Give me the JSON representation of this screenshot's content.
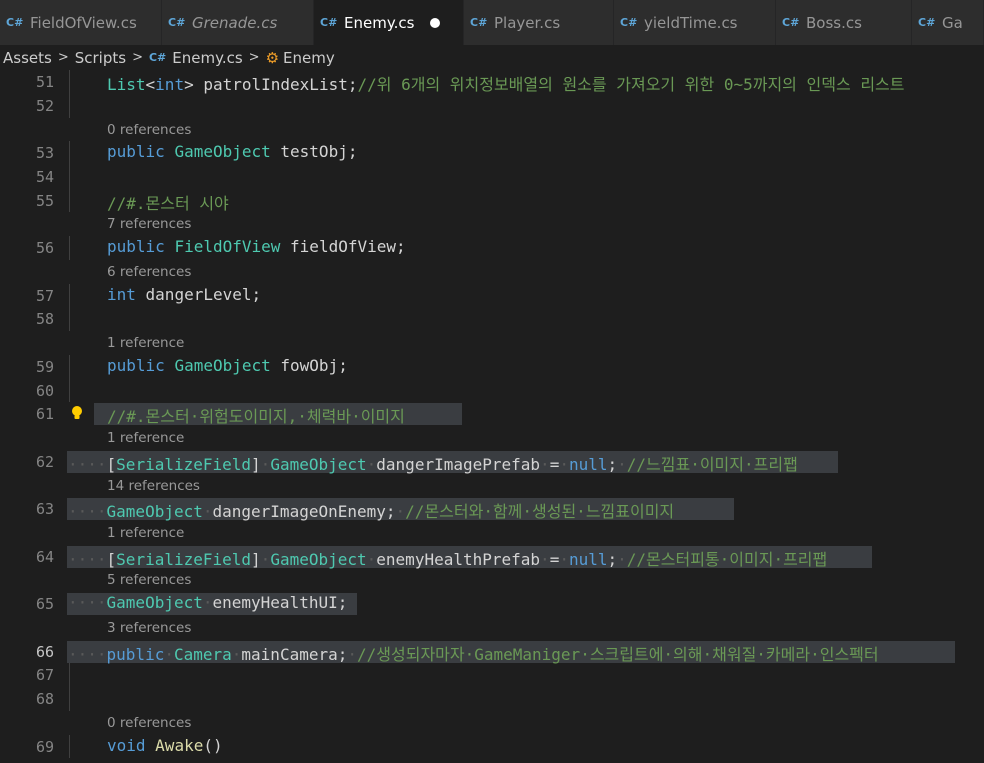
{
  "tabs": [
    {
      "name": "FieldOfView.cs",
      "active": false,
      "italic": false,
      "dirty": false
    },
    {
      "name": "Grenade.cs",
      "active": false,
      "italic": true,
      "dirty": false
    },
    {
      "name": "Enemy.cs",
      "active": true,
      "italic": false,
      "dirty": true
    },
    {
      "name": "Player.cs",
      "active": false,
      "italic": false,
      "dirty": false
    },
    {
      "name": "yieldTime.cs",
      "active": false,
      "italic": false,
      "dirty": false
    },
    {
      "name": "Boss.cs",
      "active": false,
      "italic": false,
      "dirty": false
    },
    {
      "name": "Ga",
      "active": false,
      "italic": false,
      "dirty": false
    }
  ],
  "tab_icon_text": "C#",
  "breadcrumb": [
    "Assets",
    "Scripts",
    "Enemy.cs",
    "Enemy"
  ],
  "editor": {
    "current_line": 66,
    "lines": [
      {
        "num": "51",
        "tokens": [
          [
            "ty",
            "List"
          ],
          [
            "",
            "<"
          ],
          [
            "kw",
            "int"
          ],
          [
            "",
            "> patrolIndexList;"
          ],
          [
            "cm",
            "//위 6개의 위치정보배열의 원소를 가져오기 위한 0~5까지의 인덱스 리스트"
          ]
        ]
      },
      {
        "num": "52",
        "tokens": []
      },
      {
        "lens": "0 references"
      },
      {
        "num": "53",
        "tokens": [
          [
            "kw",
            "public"
          ],
          [
            "",
            " "
          ],
          [
            "ty",
            "GameObject"
          ],
          [
            "",
            " testObj;"
          ]
        ]
      },
      {
        "num": "54",
        "tokens": []
      },
      {
        "num": "55",
        "tokens": [
          [
            "cm",
            "//#.몬스터 시야"
          ]
        ]
      },
      {
        "lens": "7 references"
      },
      {
        "num": "56",
        "tokens": [
          [
            "kw",
            "public"
          ],
          [
            "",
            " "
          ],
          [
            "ty",
            "FieldOfView"
          ],
          [
            "",
            " fieldOfView;"
          ]
        ]
      },
      {
        "lens": "6 references"
      },
      {
        "num": "57",
        "tokens": [
          [
            "kw",
            "int"
          ],
          [
            "",
            " dangerLevel;"
          ]
        ]
      },
      {
        "num": "58",
        "tokens": []
      },
      {
        "lens": "1 reference"
      },
      {
        "num": "59",
        "tokens": [
          [
            "kw",
            "public"
          ],
          [
            "",
            " "
          ],
          [
            "ty",
            "GameObject"
          ],
          [
            "",
            " fowObj;"
          ]
        ]
      },
      {
        "num": "60",
        "tokens": []
      },
      {
        "num": "61",
        "bulb": true,
        "sel": [
          94,
          462
        ],
        "tokens": [
          [
            "cm",
            "//#.몬스터·위험도이미지,·체력바·이미지"
          ]
        ]
      },
      {
        "lens": "1 reference"
      },
      {
        "num": "62",
        "sel": [
          67,
          838
        ],
        "tokens": [
          [
            "ws",
            "····"
          ],
          [
            "",
            "["
          ],
          [
            "ty",
            "SerializeField"
          ],
          [
            "",
            "]"
          ],
          [
            "ws",
            "·"
          ],
          [
            "ty",
            "GameObject"
          ],
          [
            "ws",
            "·"
          ],
          [
            "",
            "dangerImagePrefab"
          ],
          [
            "ws",
            "·"
          ],
          [
            "",
            "="
          ],
          [
            "ws",
            "·"
          ],
          [
            "kw",
            "null"
          ],
          [
            "",
            ";"
          ],
          [
            "ws",
            "·"
          ],
          [
            "cm",
            "//느낌표·이미지·프리팹"
          ]
        ]
      },
      {
        "lens": "14 references"
      },
      {
        "num": "63",
        "sel": [
          67,
          734
        ],
        "tokens": [
          [
            "ws",
            "····"
          ],
          [
            "ty",
            "GameObject"
          ],
          [
            "ws",
            "·"
          ],
          [
            "",
            "dangerImageOnEnemy;"
          ],
          [
            "ws",
            "·"
          ],
          [
            "cm",
            "//몬스터와·함께·생성된·느낌표이미지"
          ]
        ]
      },
      {
        "lens": "1 reference"
      },
      {
        "num": "64",
        "sel": [
          67,
          872
        ],
        "tokens": [
          [
            "ws",
            "····"
          ],
          [
            "",
            "["
          ],
          [
            "ty",
            "SerializeField"
          ],
          [
            "",
            "]"
          ],
          [
            "ws",
            "·"
          ],
          [
            "ty",
            "GameObject"
          ],
          [
            "ws",
            "·"
          ],
          [
            "",
            "enemyHealthPrefab"
          ],
          [
            "ws",
            "·"
          ],
          [
            "",
            "="
          ],
          [
            "ws",
            "·"
          ],
          [
            "kw",
            "null"
          ],
          [
            "",
            ";"
          ],
          [
            "ws",
            "·"
          ],
          [
            "cm",
            "//몬스터피통·이미지·프리팹"
          ]
        ]
      },
      {
        "lens": "5 references"
      },
      {
        "num": "65",
        "sel": [
          67,
          357
        ],
        "tokens": [
          [
            "ws",
            "····"
          ],
          [
            "ty",
            "GameObject"
          ],
          [
            "ws",
            "·"
          ],
          [
            "",
            "enemyHealthUI;"
          ]
        ]
      },
      {
        "lens": "3 references"
      },
      {
        "num": "66",
        "sel": [
          67,
          955
        ],
        "tokens": [
          [
            "ws",
            "····"
          ],
          [
            "kw",
            "public"
          ],
          [
            "ws",
            "·"
          ],
          [
            "ty",
            "Camera"
          ],
          [
            "ws",
            "·"
          ],
          [
            "",
            "mainCamera;"
          ],
          [
            "ws",
            "·"
          ],
          [
            "cm",
            "//생성되자마자·GameManiger·스크립트에·의해·채워질·카메라·인스펙터"
          ]
        ]
      },
      {
        "num": "67",
        "tokens": []
      },
      {
        "num": "68",
        "tokens": []
      },
      {
        "lens": "0 references"
      },
      {
        "num": "69",
        "tokens": [
          [
            "kw",
            "void"
          ],
          [
            "",
            " "
          ],
          [
            "fn",
            "Awake"
          ],
          [
            "",
            "()"
          ]
        ]
      }
    ]
  }
}
